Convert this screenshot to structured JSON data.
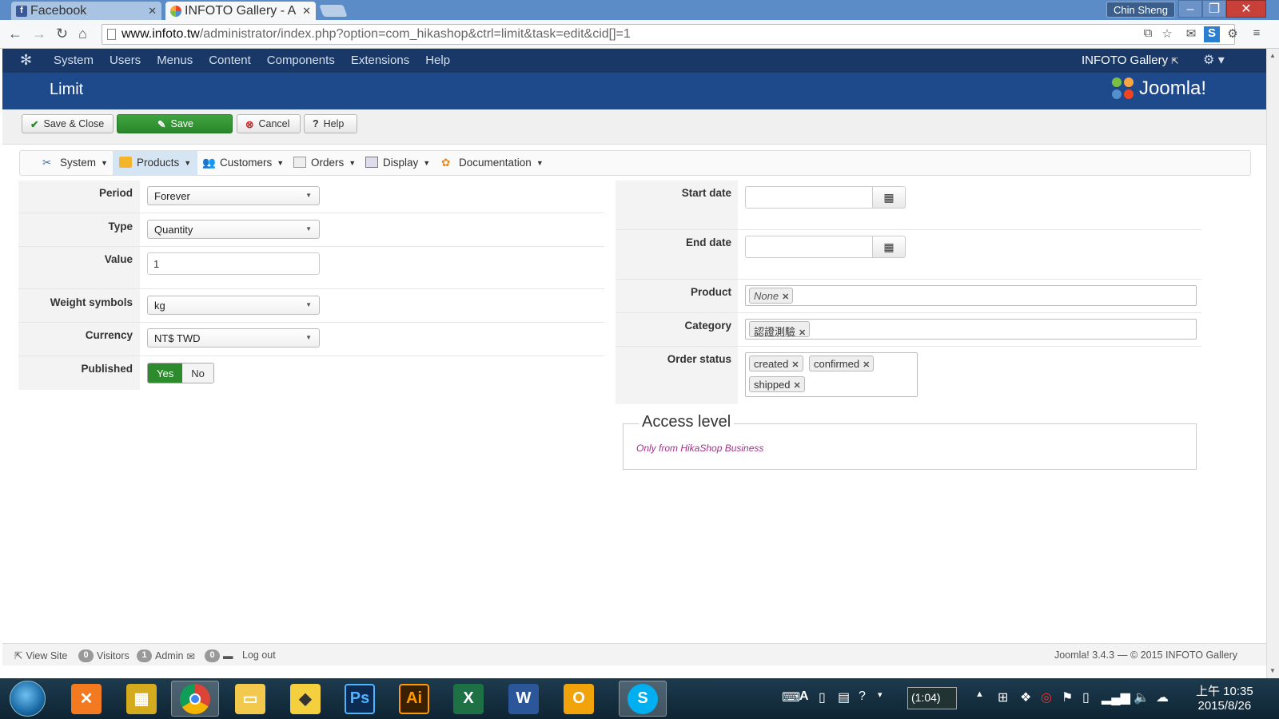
{
  "browser": {
    "tabs": [
      {
        "label": "Facebook",
        "icon": "facebook-icon"
      },
      {
        "label": "INFOTO Gallery - A",
        "icon": "joomla-icon"
      }
    ],
    "user": "Chin Sheng",
    "url_host": "www.infoto.tw",
    "url_path": "/administrator/index.php?option=com_hikashop&ctrl=limit&task=edit&cid[]=1"
  },
  "admin": {
    "menu": [
      "System",
      "Users",
      "Menus",
      "Content",
      "Components",
      "Extensions",
      "Help"
    ],
    "site_link": "INFOTO Gallery",
    "page_title": "Limit",
    "brand": "Joomla!"
  },
  "toolbar": {
    "save_close": "Save & Close",
    "save": "Save",
    "cancel": "Cancel",
    "help": "Help"
  },
  "hikanav": [
    "System",
    "Products",
    "Customers",
    "Orders",
    "Display",
    "Documentation"
  ],
  "form_left": {
    "period_label": "Period",
    "period_value": "Forever",
    "type_label": "Type",
    "type_value": "Quantity",
    "value_label": "Value",
    "value_value": "1",
    "weight_label": "Weight symbols",
    "weight_value": "kg",
    "currency_label": "Currency",
    "currency_value": "NT$ TWD",
    "published_label": "Published",
    "published_yes": "Yes",
    "published_no": "No",
    "published_selected": "Yes"
  },
  "form_right": {
    "start_label": "Start date",
    "start_value": "",
    "end_label": "End date",
    "end_value": "",
    "product_label": "Product",
    "product_tags": [
      "None"
    ],
    "category_label": "Category",
    "category_tags": [
      "認證測驗"
    ],
    "status_label": "Order status",
    "status_tags": [
      "created",
      "confirmed",
      "shipped"
    ]
  },
  "access": {
    "legend": "Access level",
    "note": "Only from HikaShop Business"
  },
  "statusbar": {
    "view_site": "View Site",
    "visitors_count": "0",
    "visitors": "Visitors",
    "admin_count": "1",
    "admin": "Admin",
    "msg_count": "0",
    "logout": "Log out",
    "version": "Joomla! 3.4.3",
    "copyright": "— © 2015 INFOTO Gallery"
  },
  "taskbar": {
    "battery": "(1:04)",
    "time": "上午 10:35",
    "date": "2015/8/26"
  },
  "colors": {
    "admin_bar": "#1a3867",
    "title_bar": "#1e4a8c",
    "save_green": "#2d8a2d",
    "access_note": "#a0338a"
  }
}
